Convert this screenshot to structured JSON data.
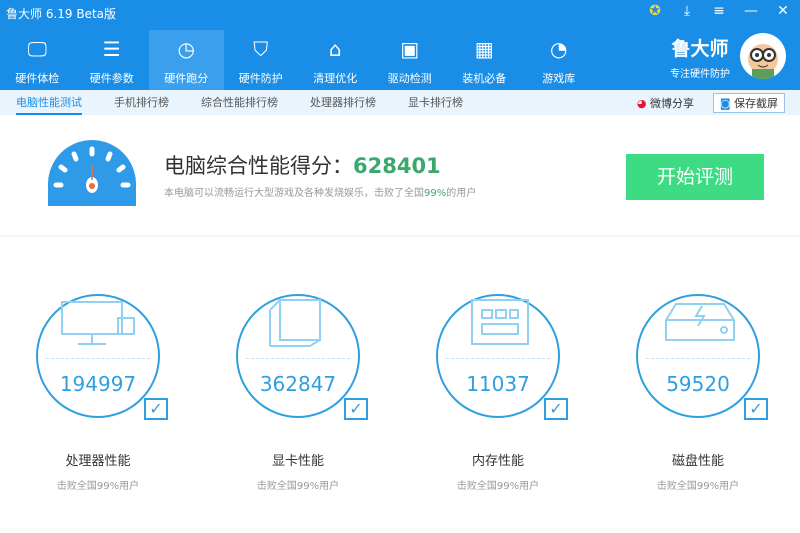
{
  "app": {
    "title": "鲁大师 6.19 Beta版"
  },
  "window_buttons": [
    "medal-icon",
    "download-icon",
    "menu-icon",
    "minimize-icon",
    "close-icon"
  ],
  "nav": [
    {
      "label": "硬件体检",
      "icon": "monitor-icon",
      "glyph": "🖵"
    },
    {
      "label": "硬件参数",
      "icon": "list-icon",
      "glyph": "☰"
    },
    {
      "label": "硬件跑分",
      "icon": "speedometer-icon",
      "glyph": "◷",
      "active": true
    },
    {
      "label": "硬件防护",
      "icon": "shield-icon",
      "glyph": "⛉"
    },
    {
      "label": "清理优化",
      "icon": "broom-icon",
      "glyph": "⌂"
    },
    {
      "label": "驱动检测",
      "icon": "toolbox-icon",
      "glyph": "▣"
    },
    {
      "label": "装机必备",
      "icon": "apps-icon",
      "glyph": "▦"
    },
    {
      "label": "游戏库",
      "icon": "pacman-icon",
      "glyph": "◔"
    }
  ],
  "brand": {
    "name": "鲁大师",
    "slogan": "专注硬件防护"
  },
  "subtabs": [
    "电脑性能测试",
    "手机排行榜",
    "综合性能排行榜",
    "处理器排行榜",
    "显卡排行榜"
  ],
  "share": "微博分享",
  "screenshot": "保存截屏",
  "score": {
    "label": "电脑综合性能得分：",
    "value": "628401",
    "desc_pre": "本电脑可以流畅运行大型游戏及各种发烧娱乐，击败了全国",
    "percent": "99%",
    "desc_post": "的用户"
  },
  "start_button": "开始评测",
  "cards": [
    {
      "value": "194997",
      "label": "处理器性能",
      "sub": "击败全国99%用户"
    },
    {
      "value": "362847",
      "label": "显卡性能",
      "sub": "击败全国99%用户"
    },
    {
      "value": "11037",
      "label": "内存性能",
      "sub": "击败全国99%用户"
    },
    {
      "value": "59520",
      "label": "磁盘性能",
      "sub": "击败全国99%用户"
    }
  ],
  "colors": {
    "primary": "#1a8ee6",
    "accent_green": "#3ddc84",
    "score_green": "#3aa86d"
  }
}
